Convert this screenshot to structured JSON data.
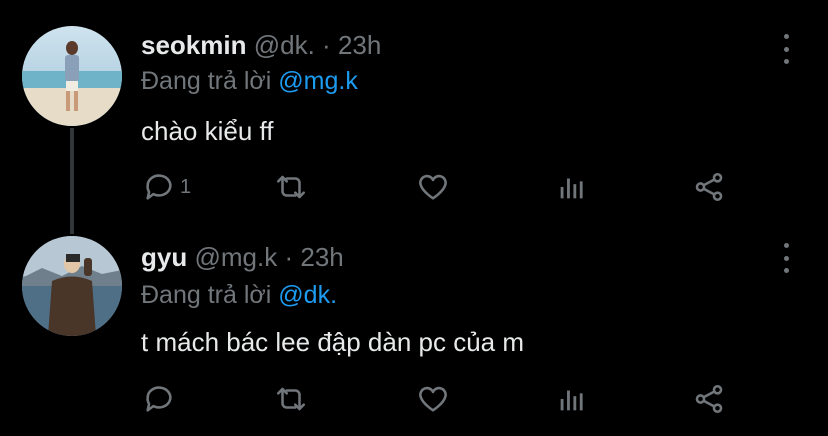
{
  "tweets": [
    {
      "display_name": "seokmin",
      "handle": "@dk.",
      "separator": "·",
      "time": "23h",
      "replying_prefix": "Đang trả lời",
      "replying_to": "@mg.k",
      "text": "chào kiểu ff",
      "reply_count": "1",
      "avatar_icon": "beach-photo-avatar"
    },
    {
      "display_name": "gyu",
      "handle": "@mg.k",
      "separator": "·",
      "time": "23h",
      "replying_prefix": "Đang trả lời",
      "replying_to": "@dk.",
      "text": "t mách bác lee đập dàn pc của m",
      "reply_count": "",
      "avatar_icon": "lake-photo-avatar"
    }
  ],
  "colors": {
    "background": "#000000",
    "text": "#e7e9ea",
    "muted": "#71767b",
    "link": "#1d9bf0",
    "thread_line": "#333639"
  },
  "icons": [
    "reply-icon",
    "retweet-icon",
    "like-icon",
    "views-icon",
    "share-icon",
    "more-icon"
  ]
}
